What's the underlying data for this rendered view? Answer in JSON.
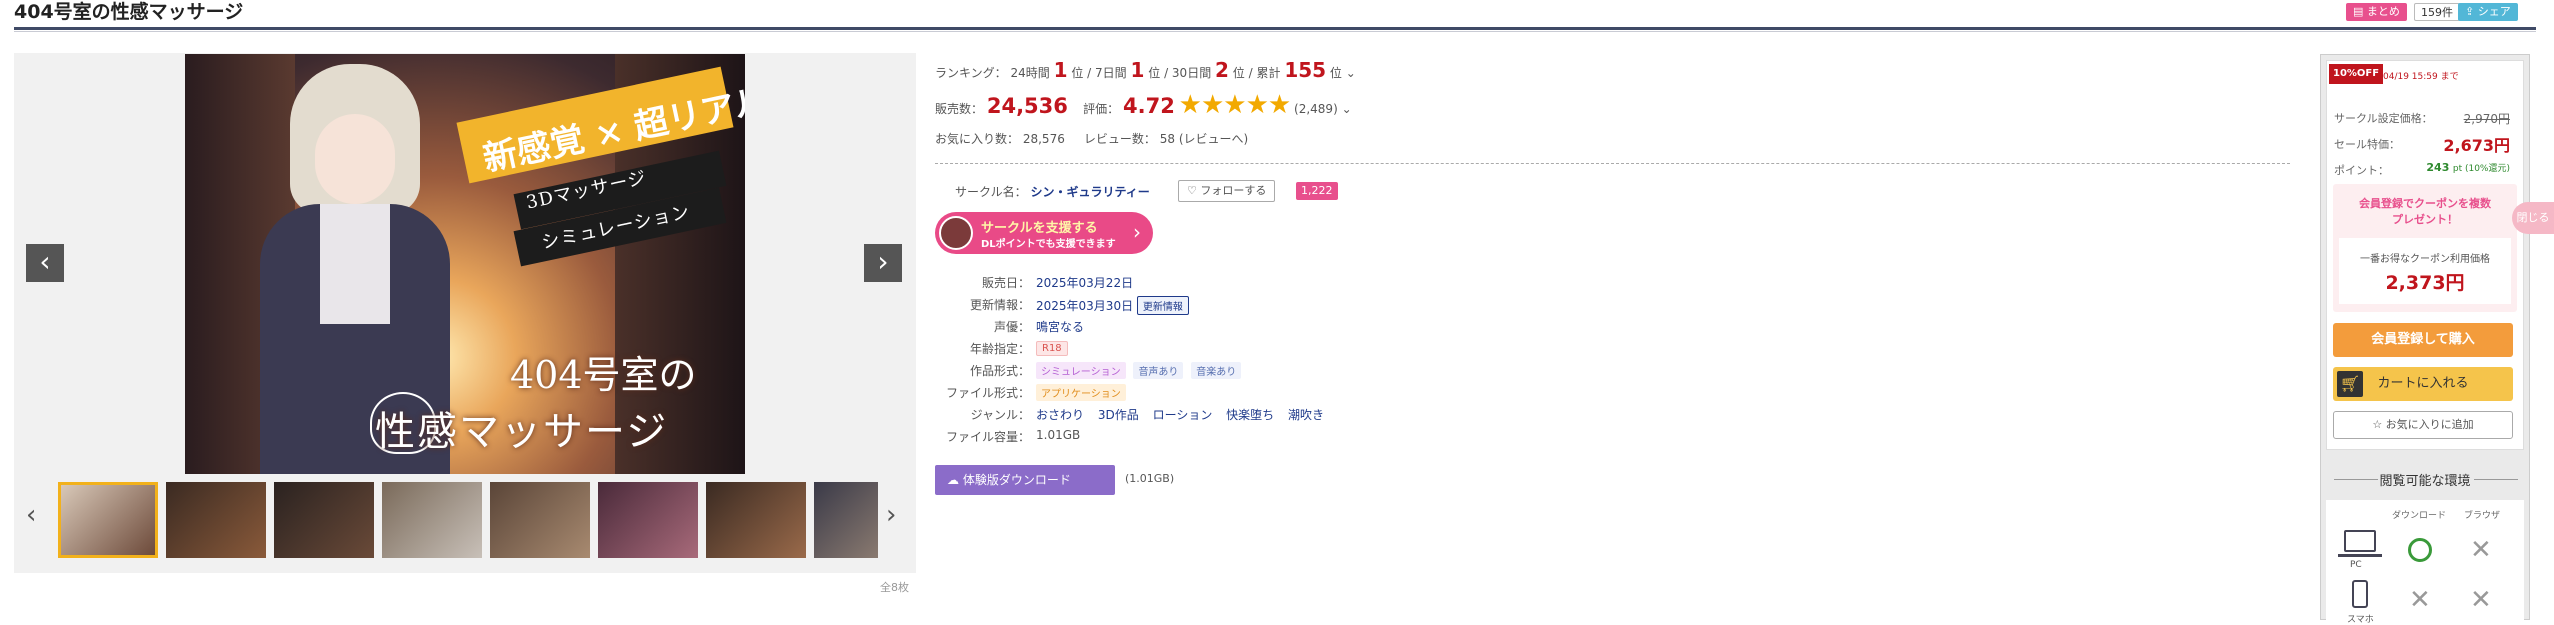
{
  "header": {
    "title": "404号室の性感マッサージ",
    "matome_label": "まとめ",
    "matome_count": "159件",
    "share_label": "シェア"
  },
  "gallery": {
    "image_texts": {
      "catch_a": "新感覚 × 超リアル",
      "catch_b": "3Dマッサージ",
      "catch_c": "シミュレーション",
      "logo_1": "404号室の",
      "logo_2": "性感マッサージ"
    },
    "thumb_count_text": "全8枚",
    "colors": {
      "active_border": "#f2b11b",
      "nav_bg": "#555555"
    }
  },
  "ranking": {
    "label": "ランキング：",
    "h24_label": "24時間",
    "h24_value": "1",
    "unit": "位",
    "d7_label": "7日間",
    "d7_value": "1",
    "d30_label": "30日間",
    "d30_value": "2",
    "total_label": "累計",
    "total_value": "155"
  },
  "stats": {
    "sales_label": "販売数：",
    "sales_value": "24,536",
    "rating_label": "評価：",
    "rating_value": "4.72",
    "rating_stars": 4.72,
    "stars_glyph": "★★★★★",
    "rating_count": "(2,489)",
    "favorites_label": "お気に入り数：",
    "favorites_value": "28,576",
    "reviews_label": "レビュー数：",
    "reviews_value": "58",
    "reviews_link": "(レビューへ)"
  },
  "circle": {
    "label": "サークル名：",
    "name": "シン・ギュラリティー",
    "follow_label": "フォローする",
    "follower_count": "1,222",
    "support_line1": "サークルを支援する",
    "support_line2": "DLポイントでも支援できます"
  },
  "specs": {
    "release_label": "販売日：",
    "release_value": "2025年03月22日",
    "update_label": "更新情報：",
    "update_value": "2025年03月30日",
    "update_tag": "更新情報",
    "cv_label": "声優：",
    "cv_value": "鳴宮なる",
    "age_label": "年齢指定：",
    "age_value": "R18",
    "format_label": "作品形式：",
    "format_tags": [
      "シミュレーション",
      "音声あり",
      "音楽あり"
    ],
    "file_label": "ファイル形式：",
    "file_value": "アプリケーション",
    "genre_label": "ジャンル：",
    "genres": [
      "おさわり",
      "3D作品",
      "ローション",
      "快楽堕ち",
      "潮吹き"
    ],
    "size_label": "ファイル容量：",
    "size_value": "1.01GB"
  },
  "trial": {
    "label": "体験版ダウンロード",
    "size": "(1.01GB)"
  },
  "purchase": {
    "off_badge": "10%OFF",
    "sale_end": "04/19 15:59 まで",
    "list_price_label": "サークル設定価格：",
    "list_price": "2,970円",
    "sale_price_label": "セール特価：",
    "sale_price": "2,673円",
    "point_label": "ポイント：",
    "point_value": "243",
    "point_unit": "pt (10%還元)",
    "coupon_head_1": "会員登録でクーポンを複数",
    "coupon_head_2": "プレゼント！",
    "coupon_caption": "一番お得なクーポン利用価格",
    "coupon_price": "2,373円",
    "side_tab": "閉じる",
    "buy_label": "会員登録して購入",
    "cart_label": "カートに入れる",
    "fav_label": "お気に入りに追加",
    "env_title": "閲覧可能な環境",
    "env_col_download": "ダウンロード",
    "env_col_browser": "ブラウザ",
    "env_pc": "PC",
    "env_phone": "スマホ",
    "colors": {
      "sale_red": "#c0151d",
      "buy_orange": "#f39c3c",
      "cart_yellow": "#f5c44b",
      "point_green": "#2f8a2f"
    }
  }
}
